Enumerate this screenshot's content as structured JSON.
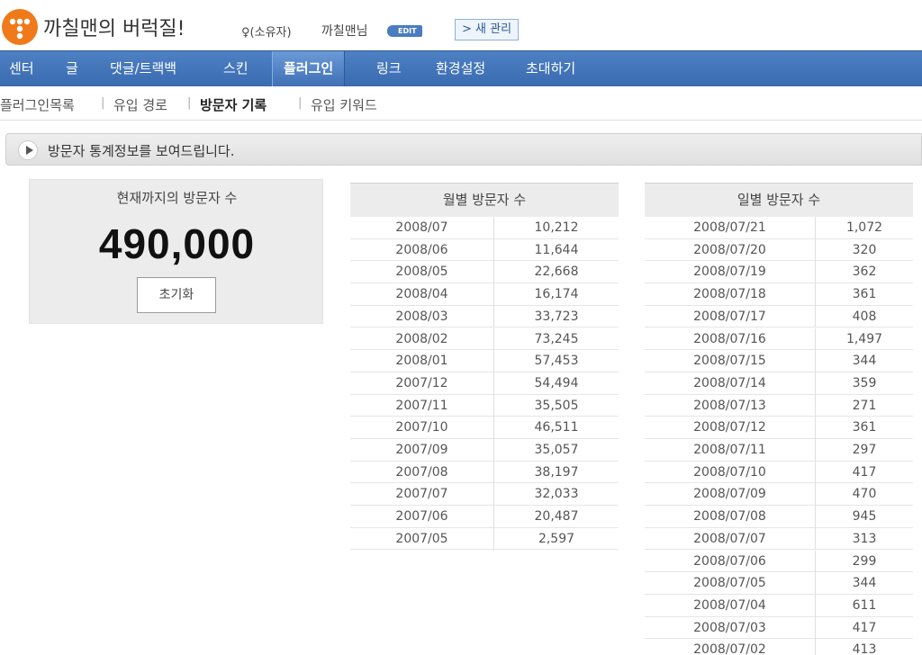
{
  "header": {
    "blog_title": "까칠맨의 버럭질!",
    "owner_role": "(소유자)",
    "owner_name": "까칠맨님",
    "edit_label": "EDIT",
    "manage_label": "> 새 관리"
  },
  "nav": {
    "items": [
      "센터",
      "글",
      "댓글/트랙백",
      "스킨",
      "플러그인",
      "링크",
      "환경설정",
      "초대하기"
    ],
    "active": "플러그인"
  },
  "subnav": {
    "items": [
      "플러그인목록",
      "유입 경로",
      "방문자 기록",
      "유입 키워드"
    ],
    "active": "방문자 기록"
  },
  "info": {
    "message": "방문자 통계정보를 보여드립니다."
  },
  "total": {
    "label": "현재까지의 방문자 수",
    "value": "490,000",
    "reset_label": "초기화"
  },
  "monthly": {
    "title": "월별 방문자 수",
    "rows": [
      [
        "2008/07",
        "10,212"
      ],
      [
        "2008/06",
        "11,644"
      ],
      [
        "2008/05",
        "22,668"
      ],
      [
        "2008/04",
        "16,174"
      ],
      [
        "2008/03",
        "33,723"
      ],
      [
        "2008/02",
        "73,245"
      ],
      [
        "2008/01",
        "57,453"
      ],
      [
        "2007/12",
        "54,494"
      ],
      [
        "2007/11",
        "35,505"
      ],
      [
        "2007/10",
        "46,511"
      ],
      [
        "2007/09",
        "35,057"
      ],
      [
        "2007/08",
        "38,197"
      ],
      [
        "2007/07",
        "32,033"
      ],
      [
        "2007/06",
        "20,487"
      ],
      [
        "2007/05",
        "2,597"
      ]
    ]
  },
  "daily": {
    "title": "일별 방문자 수",
    "rows": [
      [
        "2008/07/21",
        "1,072"
      ],
      [
        "2008/07/20",
        "320"
      ],
      [
        "2008/07/19",
        "362"
      ],
      [
        "2008/07/18",
        "361"
      ],
      [
        "2008/07/17",
        "408"
      ],
      [
        "2008/07/16",
        "1,497"
      ],
      [
        "2008/07/15",
        "344"
      ],
      [
        "2008/07/14",
        "359"
      ],
      [
        "2008/07/13",
        "271"
      ],
      [
        "2008/07/12",
        "361"
      ],
      [
        "2008/07/11",
        "297"
      ],
      [
        "2008/07/10",
        "417"
      ],
      [
        "2008/07/09",
        "470"
      ],
      [
        "2008/07/08",
        "945"
      ],
      [
        "2008/07/07",
        "313"
      ],
      [
        "2008/07/06",
        "299"
      ],
      [
        "2008/07/05",
        "344"
      ],
      [
        "2008/07/04",
        "611"
      ],
      [
        "2008/07/03",
        "417"
      ],
      [
        "2008/07/02",
        "413"
      ]
    ]
  },
  "colors": {
    "brand_orange": "#f07a1a",
    "nav_blue": "#3a6bb0",
    "edit_blue": "#4a7cc0"
  }
}
